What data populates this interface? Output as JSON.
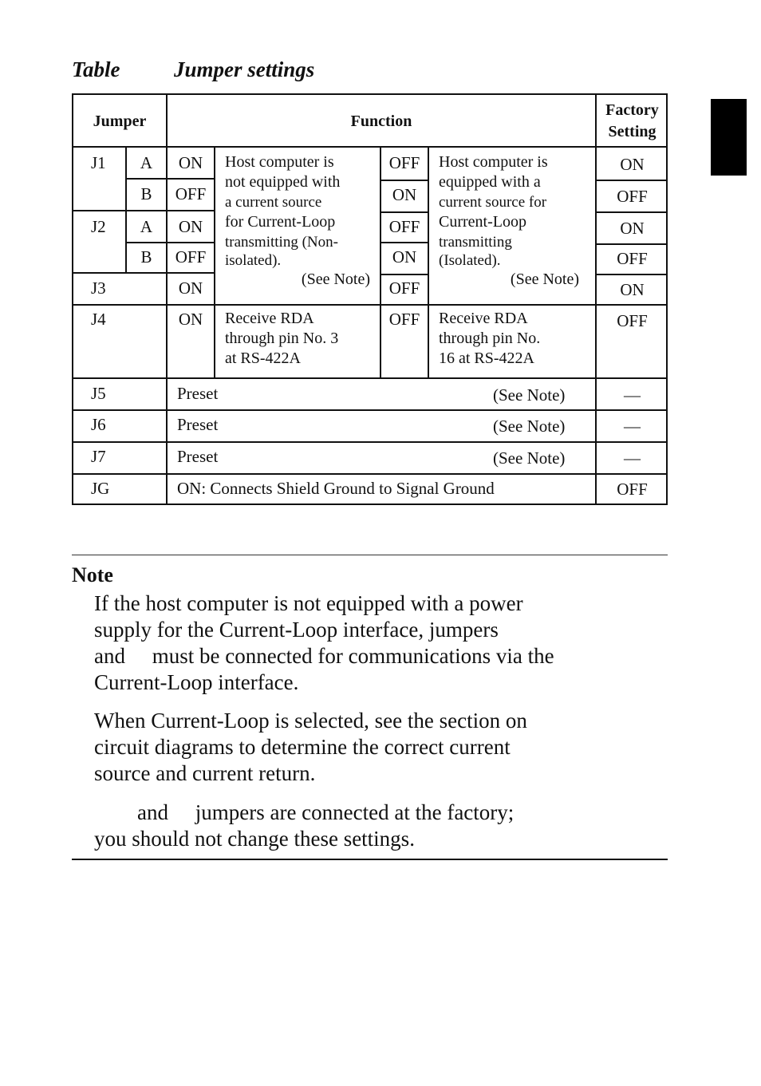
{
  "title": {
    "label": "Table",
    "text": "Jumper settings"
  },
  "table": {
    "headers": {
      "jumper": "Jumper",
      "function": "Function",
      "factory": [
        "Factory",
        "Setting"
      ]
    },
    "group1": {
      "rows": [
        {
          "jumper": "J1",
          "sub": "A",
          "left_state": "ON",
          "right_state": "OFF",
          "factory": "ON"
        },
        {
          "jumper": "",
          "sub": "B",
          "left_state": "OFF",
          "right_state": "ON",
          "factory": "OFF"
        },
        {
          "jumper": "J2",
          "sub": "A",
          "left_state": "ON",
          "right_state": "OFF",
          "factory": "ON"
        },
        {
          "jumper": "",
          "sub": "B",
          "left_state": "OFF",
          "right_state": "ON",
          "factory": "OFF"
        },
        {
          "jumper": "J3",
          "sub": "",
          "left_state": "ON",
          "right_state": "OFF",
          "factory": "ON"
        }
      ],
      "left_desc": [
        "Host computer is",
        "not equipped with",
        "a current source",
        "for Current-Loop",
        "transmitting (Non-",
        "isolated)."
      ],
      "left_note": "(See Note)",
      "right_desc": [
        "Host computer is",
        "equipped with a",
        "current source for",
        "Current-Loop",
        "transmitting",
        "(Isolated)."
      ],
      "right_note": "(See Note)"
    },
    "j4": {
      "jumper": "J4",
      "left_state": "ON",
      "left_desc": [
        "Receive RDA",
        "through pin No. 3",
        "at RS-422A"
      ],
      "right_state": "OFF",
      "right_desc": [
        "Receive RDA",
        "through pin No.",
        "16 at RS-422A"
      ],
      "factory": "OFF"
    },
    "simple_rows": [
      {
        "jumper": "J5",
        "function": "Preset",
        "note": "(See Note)",
        "factory": "—"
      },
      {
        "jumper": "J6",
        "function": "Preset",
        "note": "(See Note)",
        "factory": "—"
      },
      {
        "jumper": "J7",
        "function": "Preset",
        "note": "(See Note)",
        "factory": "—"
      },
      {
        "jumper": "JG",
        "function": "ON: Connects Shield Ground to Signal Ground",
        "note": "",
        "factory": "OFF"
      }
    ]
  },
  "note": {
    "heading": "Note",
    "paragraphs": [
      [
        "If the host computer is not equipped with a power",
        "supply for the Current-Loop interface, jumpers",
        "and     must be connected for communications via the",
        "Current-Loop interface."
      ],
      [
        "When Current-Loop is selected, see the section on",
        "circuit diagrams to determine the correct current",
        "source and current return."
      ],
      [
        "        and     jumpers are connected at the factory;",
        "you should not change these settings."
      ]
    ]
  }
}
